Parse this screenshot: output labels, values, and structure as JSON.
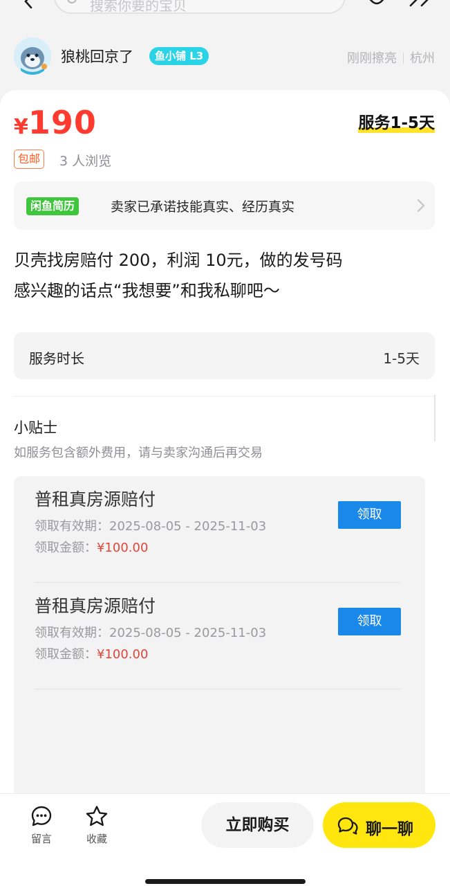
{
  "search": {
    "placeholder": "搜索你要的宝贝"
  },
  "seller": {
    "name": "狼桃回京了",
    "badge": "鱼小铺 L3",
    "last_active": "刚刚擦亮",
    "location": "杭州"
  },
  "item": {
    "currency": "¥",
    "price": "190",
    "service_tag": "服务1-5天",
    "postage": "包邮",
    "views": "3 人浏览",
    "description_lines": [
      "贝壳找房赔付 200，利润 10元，做的发号码",
      "感兴趣的话点“我想要”和我私聊吧～"
    ]
  },
  "resume": {
    "logo": "闲鱼简历",
    "text": "卖家已承诺技能真实、经历真实"
  },
  "duration": {
    "label": "服务时长",
    "value": "1-5天"
  },
  "tips": {
    "title": "小贴士",
    "subtitle": "如服务包含额外费用，请与卖家沟通后再交易"
  },
  "coupons": [
    {
      "title": "普租真房源赔付",
      "date_label": "领取有效期：",
      "date_value": "2025-08-05 - 2025-11-03",
      "amount_label": "领取金额：",
      "amount_value": "¥100.00",
      "button": "领取"
    },
    {
      "title": "普租真房源赔付",
      "date_label": "领取有效期：",
      "date_value": "2025-08-05 - 2025-11-03",
      "amount_label": "领取金额：",
      "amount_value": "¥100.00",
      "button": "领取"
    }
  ],
  "bottom_bar": {
    "message_label": "留言",
    "favorite_label": "收藏",
    "buy_label": "立即购买",
    "chat_label": "聊一聊"
  },
  "colors": {
    "price_red": "#ff3b30",
    "accent_yellow": "#ffe60f",
    "claim_blue": "#1a88e8",
    "resume_green": "#3fc63c",
    "shop_badge_cyan": "#2bd3e6"
  }
}
